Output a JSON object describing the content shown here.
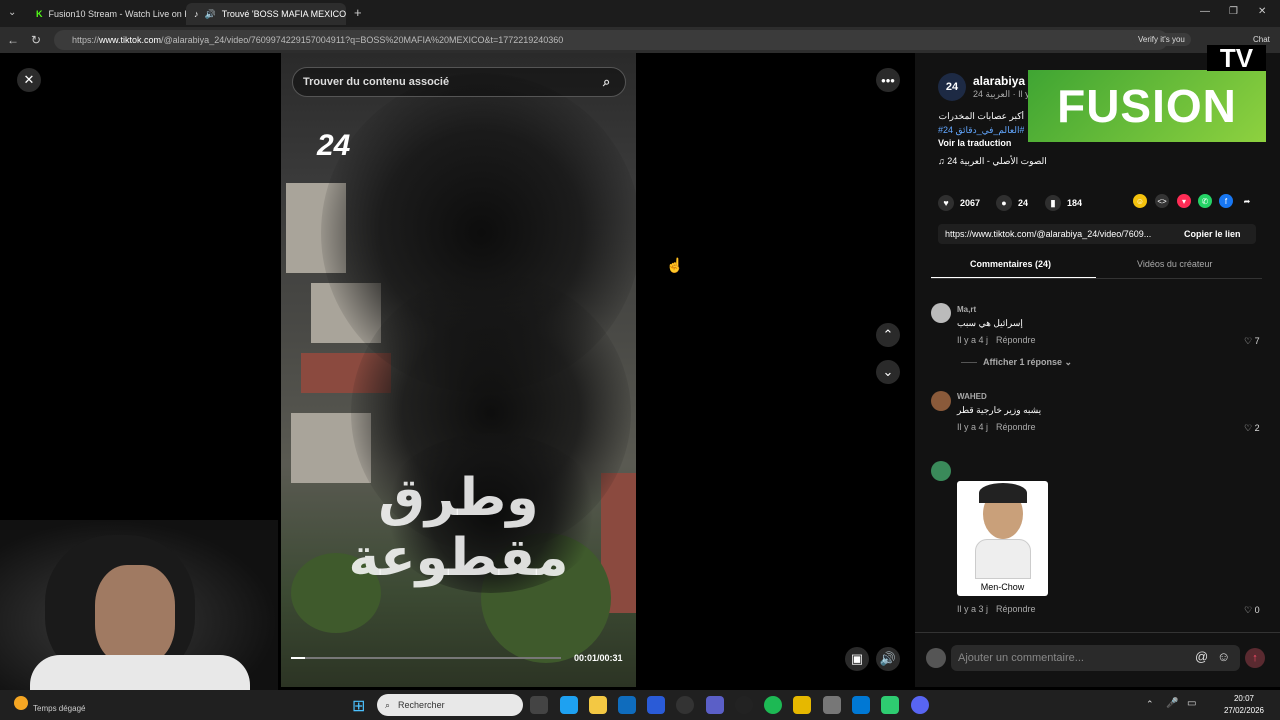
{
  "browser": {
    "tabs": [
      {
        "title": "Fusion10 Stream - Watch Live on K",
        "active": false
      },
      {
        "title": "Trouvé 'BOSS MAFIA MEXICO'",
        "active": true
      }
    ],
    "url_prefix": "https://",
    "url_domain": "www.tiktok.com",
    "url_path": "/@alarabiya_24/video/7609974229157004911?q=BOSS%20MAFIA%20MEXICO&t=1772219240360",
    "verify_label": "Verify it's you",
    "chat_label": "Chat"
  },
  "video": {
    "search_placeholder": "Trouver du contenu associé",
    "logo_text": "24",
    "overlay_text": "وطرق مقطوعة",
    "time": "00:01/00:31"
  },
  "panel": {
    "author": "alarabiya",
    "author_sub": "24 العربية · Il y",
    "caption": "أكبر عصابات المخدرات",
    "hashtags": "#24 العالم_في_دقائق#",
    "translate": "Voir la traduction",
    "sound": "الصوت الأصلي - العربية 24",
    "likes": "2067",
    "comments": "24",
    "saves": "184",
    "link": "https://www.tiktok.com/@alarabiya_24/video/7609...",
    "copy_label": "Copier le lien",
    "tab_comments": "Commentaires (24)",
    "tab_videos": "Vidéos du créateur",
    "comment_placeholder": "Ajouter un commentaire..."
  },
  "comments": [
    {
      "name": "Ma,rt",
      "text": "إسرائيل هي سبب",
      "time": "Il y a 4 j",
      "reply": "Répondre",
      "likes": "7",
      "more": "Afficher 1 réponse"
    },
    {
      "name": "WAHED",
      "text": "يشبه وزير خارجية قطر",
      "time": "Il y a 4 j",
      "reply": "Répondre",
      "likes": "2"
    },
    {
      "name": "",
      "caption": "Men-Chow",
      "time": "Il y a 3 j",
      "reply": "Répondre",
      "likes": "0"
    }
  ],
  "overlay": {
    "brand": "FUSION",
    "tv": "TV"
  },
  "taskbar": {
    "search": "Rechercher",
    "weather": "Temps dégagé",
    "time": "20:07",
    "date": "27/02/2026"
  }
}
